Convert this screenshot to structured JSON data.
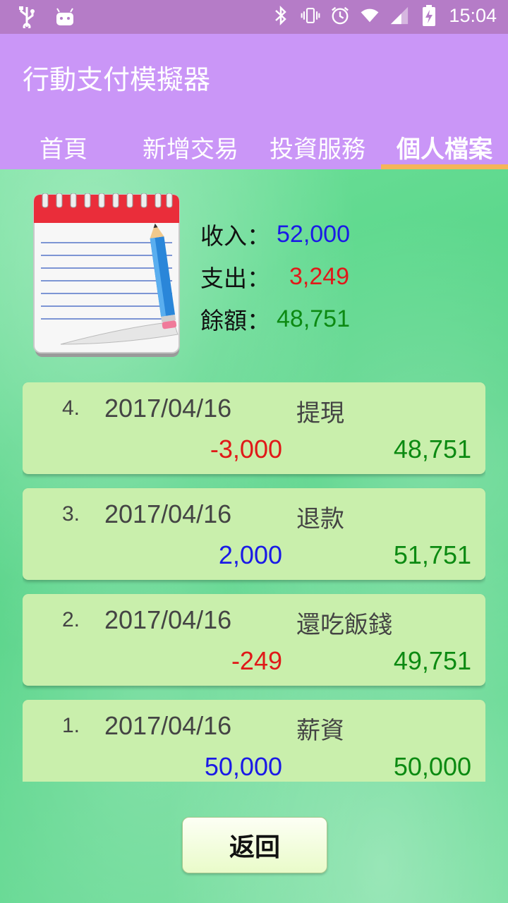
{
  "status_bar": {
    "time": "15:04",
    "icons_left": [
      "usb-icon",
      "android-icon"
    ],
    "icons_right": [
      "bluetooth-icon",
      "vibrate-icon",
      "alarm-icon",
      "wifi-icon",
      "signal-icon",
      "battery-charging-icon"
    ]
  },
  "app": {
    "title": "行動支付模擬器"
  },
  "tabs": [
    {
      "label": "首頁",
      "active": false
    },
    {
      "label": "新增交易",
      "active": false
    },
    {
      "label": "投資服務",
      "active": false
    },
    {
      "label": "個人檔案",
      "active": true
    }
  ],
  "summary": {
    "income_label": "收入：",
    "income_value": "52,000",
    "expense_label": "支出：",
    "expense_value": "3,249",
    "balance_label": "餘額：",
    "balance_value": "48,751"
  },
  "transactions": [
    {
      "index": "4.",
      "date": "2017/04/16",
      "desc": "提現",
      "amount": "-3,000",
      "balance": "48,751"
    },
    {
      "index": "3.",
      "date": "2017/04/16",
      "desc": "退款",
      "amount": "2,000",
      "balance": "51,751"
    },
    {
      "index": "2.",
      "date": "2017/04/16",
      "desc": "還吃飯錢",
      "amount": "-249",
      "balance": "49,751"
    },
    {
      "index": "1.",
      "date": "2017/04/16",
      "desc": "薪資",
      "amount": "50,000",
      "balance": "50,000"
    }
  ],
  "back_button": {
    "label": "返回"
  },
  "colors": {
    "status_bar": "#b57cc7",
    "app_bar": "#ca96f7",
    "tab_indicator": "#f5b55a",
    "income": "#1a1ae6",
    "expense": "#e01919",
    "balance": "#0c8a12",
    "card": "#c9efac"
  }
}
